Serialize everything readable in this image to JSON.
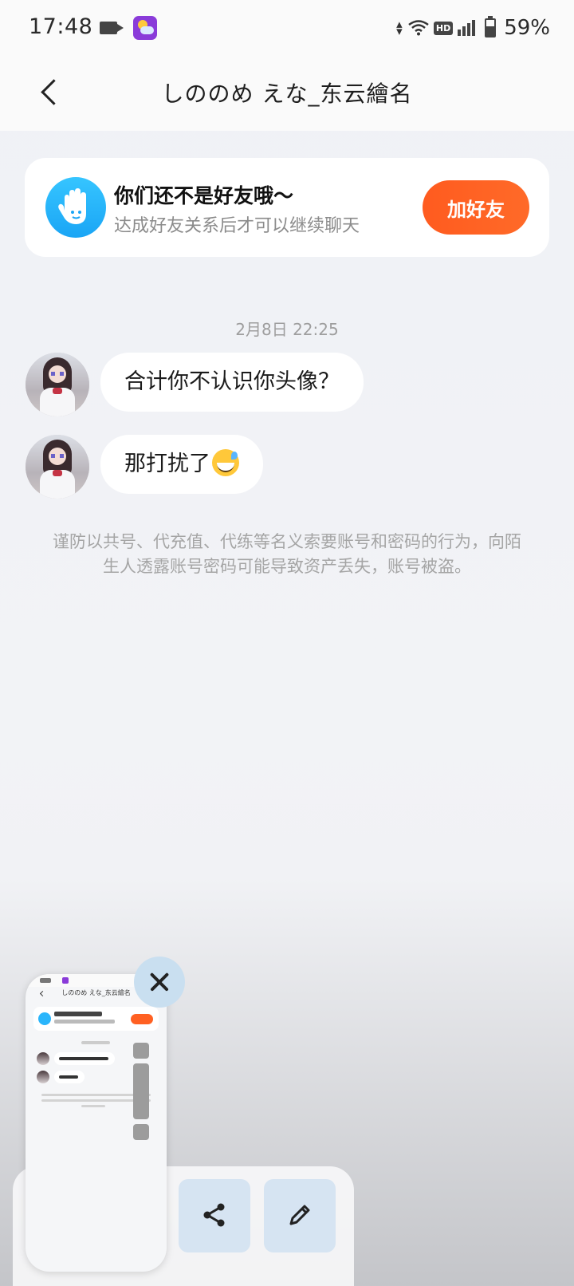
{
  "status_bar": {
    "time": "17:48",
    "network": "HD",
    "battery": "59%",
    "battery_level": 0.59
  },
  "header": {
    "title": "しののめ えな_东云繪名"
  },
  "friend_banner": {
    "title": "你们还不是好友哦～",
    "subtitle": "达成好友关系后才可以继续聊天",
    "button_label": "加好友",
    "accent_color": "#ff5b1f",
    "icon": "waving-hand-icon"
  },
  "chat": {
    "timestamp": "2月8日 22:25",
    "messages": [
      {
        "text": "合计你不认识你头像？",
        "emoji": ""
      },
      {
        "text": "那打扰了",
        "emoji": "sweat-smile"
      }
    ],
    "warning": "谨防以共号、代充值、代练等名义索要账号和密码的行为，向陌生人透露账号密码可能导致资产丢失，账号被盗。"
  },
  "dock": {
    "icons": [
      "close-icon",
      "share-icon",
      "edit-icon"
    ]
  }
}
